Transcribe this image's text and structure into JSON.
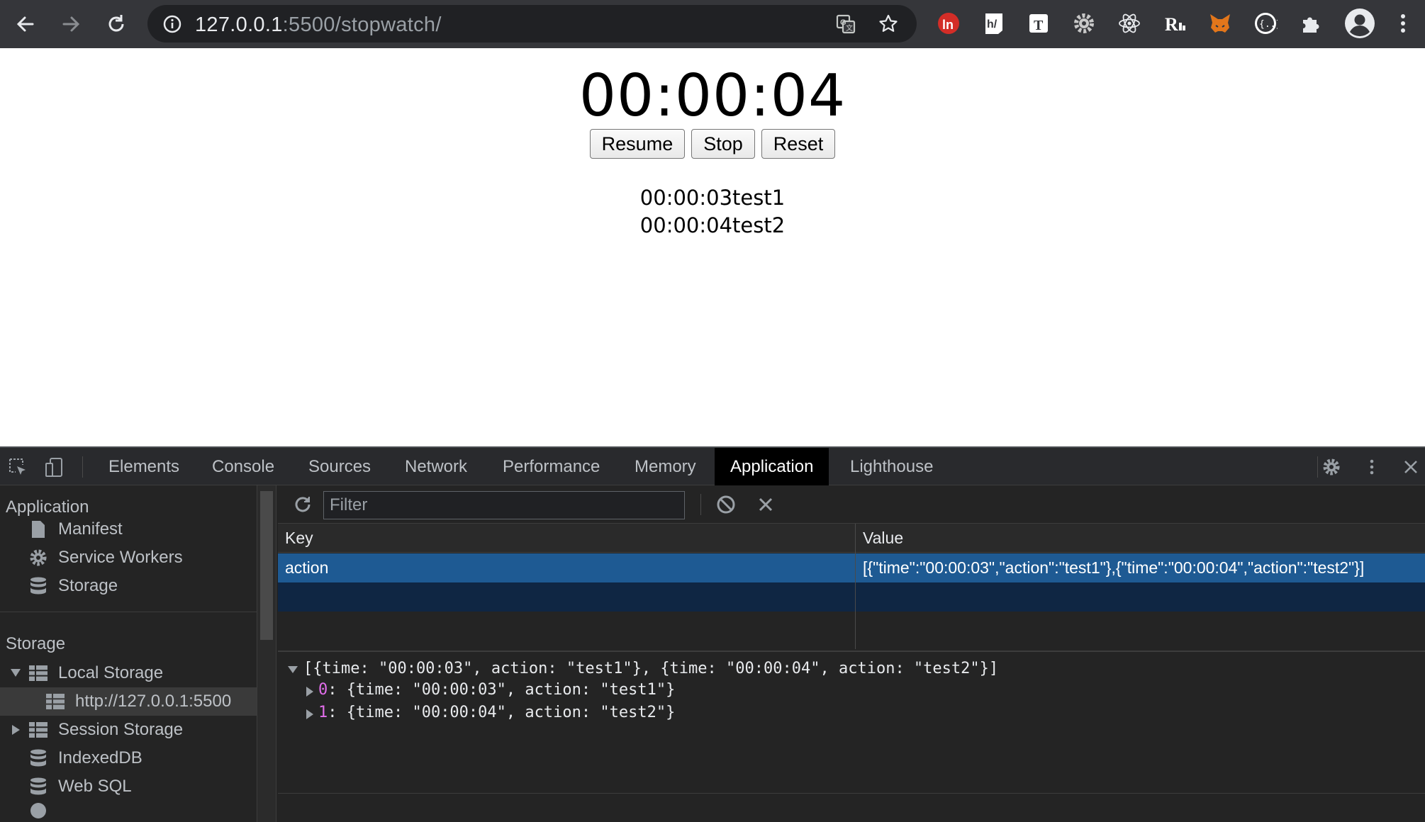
{
  "browser": {
    "url_host": "127.0.0.1",
    "url_path": ":5500/stopwatch/"
  },
  "page": {
    "time_display": "00:00:04",
    "buttons": {
      "resume": "Resume",
      "stop": "Stop",
      "reset": "Reset"
    },
    "logs": [
      "00:00:03test1",
      "00:00:04test2"
    ]
  },
  "devtools": {
    "tabs": [
      "Elements",
      "Console",
      "Sources",
      "Network",
      "Performance",
      "Memory",
      "Application",
      "Lighthouse"
    ],
    "active_tab": "Application",
    "sidebar": {
      "application_header": "Application",
      "manifest": "Manifest",
      "service_workers": "Service Workers",
      "storage_item": "Storage",
      "storage_header": "Storage",
      "local_storage": "Local Storage",
      "local_origin": "http://127.0.0.1:5500",
      "session_storage": "Session Storage",
      "indexeddb": "IndexedDB",
      "websql": "Web SQL"
    },
    "filter_placeholder": "Filter",
    "table": {
      "key_header": "Key",
      "value_header": "Value",
      "rows": [
        {
          "key": "action",
          "value": "[{\"time\":\"00:00:03\",\"action\":\"test1\"},{\"time\":\"00:00:04\",\"action\":\"test2\"}]"
        }
      ]
    },
    "preview": {
      "summary": "[{time: \"00:00:03\", action: \"test1\"}, {time: \"00:00:04\", action: \"test2\"}]",
      "items": [
        {
          "index": "0",
          "text": ": {time: \"00:00:03\", action: \"test1\"}"
        },
        {
          "index": "1",
          "text": ": {time: \"00:00:04\", action: \"test2\"}"
        }
      ]
    }
  },
  "colors": {
    "toolbar": "#35363a",
    "selected_row": "#1e5a93",
    "index_magenta": "#e36eec"
  }
}
